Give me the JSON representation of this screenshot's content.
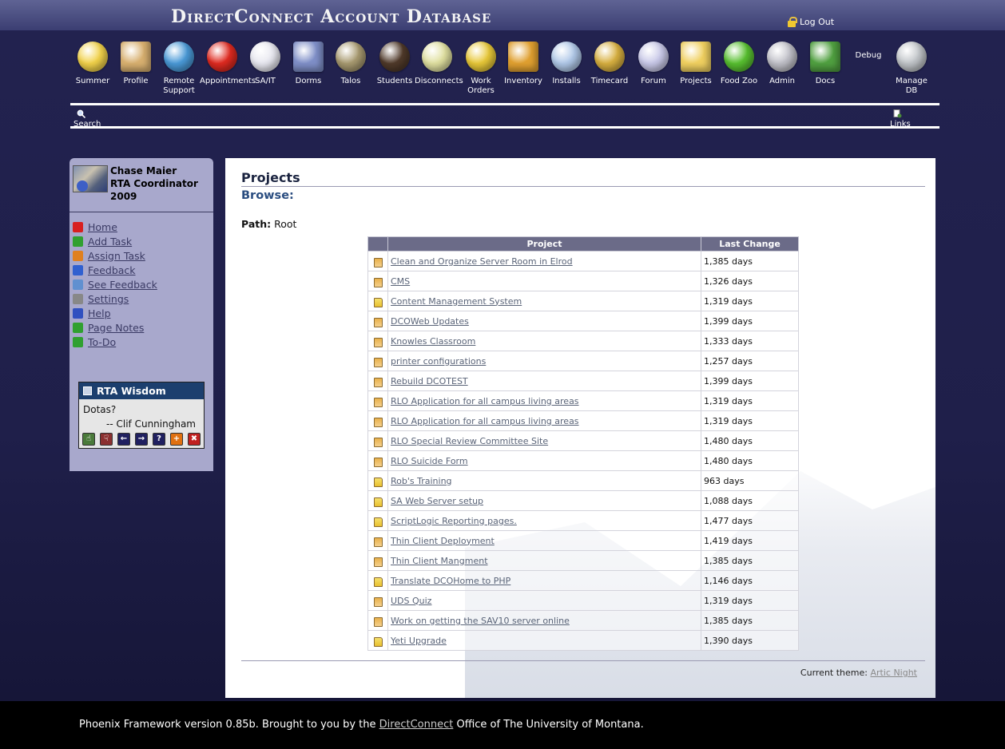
{
  "header": {
    "title": "DirectConnect Account Database",
    "logout_label": "Log Out"
  },
  "toolbar": [
    {
      "label": "Summer",
      "icon": "smiley-sunglasses-icon",
      "color": "#f2d24a"
    },
    {
      "label": "Profile",
      "icon": "profile-portrait-icon",
      "color": "#d8b070"
    },
    {
      "label": "Remote Support",
      "icon": "globe-help-icon",
      "color": "#4a9ad8"
    },
    {
      "label": "Appointments",
      "icon": "alarm-clock-icon",
      "color": "#e02a20"
    },
    {
      "label": "SA/IT",
      "icon": "medical-cross-icon",
      "color": "#e8e8f0"
    },
    {
      "label": "Dorms",
      "icon": "building-icon",
      "color": "#7f8fc8"
    },
    {
      "label": "Talos",
      "icon": "skull-helmet-icon",
      "color": "#a89a70"
    },
    {
      "label": "Students",
      "icon": "person-icon",
      "color": "#503a2a"
    },
    {
      "label": "Disconnects",
      "icon": "unplug-cable-icon",
      "color": "#e0e0a0"
    },
    {
      "label": "Work Orders",
      "icon": "note-pin-icon",
      "color": "#e8c838"
    },
    {
      "label": "Inventory",
      "icon": "box-icon",
      "color": "#e0a030"
    },
    {
      "label": "Installs",
      "icon": "install-disc-icon",
      "color": "#b0c8e8"
    },
    {
      "label": "Timecard",
      "icon": "money-bag-icon",
      "color": "#d8b040"
    },
    {
      "label": "Forum",
      "icon": "speech-bubbles-icon",
      "color": "#c8c8e8"
    },
    {
      "label": "Projects",
      "icon": "folder-icon",
      "color": "#f0d060"
    },
    {
      "label": "Food Zoo",
      "icon": "apple-icon",
      "color": "#58c030"
    },
    {
      "label": "Admin",
      "icon": "gears-icon",
      "color": "#c0c0c8"
    },
    {
      "label": "Docs",
      "icon": "books-icon",
      "color": "#50a040"
    },
    {
      "label": "Debug",
      "icon": "",
      "color": ""
    },
    {
      "label": "Manage DB",
      "icon": "database-check-icon",
      "color": "#c0c4c8"
    }
  ],
  "subnav": {
    "search_label": "Search",
    "links_label": "Links"
  },
  "user": {
    "name": "Chase Maier",
    "role": "RTA Coordinator",
    "year": "2009"
  },
  "side_menu": [
    {
      "label": "Home",
      "icon": "house-icon",
      "color": "#d82020"
    },
    {
      "label": "Add Task",
      "icon": "checkmark-icon",
      "color": "#30a030"
    },
    {
      "label": "Assign Task",
      "icon": "assign-icon",
      "color": "#e08020"
    },
    {
      "label": "Feedback",
      "icon": "info-icon",
      "color": "#3060d0"
    },
    {
      "label": "See Feedback",
      "icon": "magnifier-icon",
      "color": "#6090d0"
    },
    {
      "label": "Settings",
      "icon": "tools-icon",
      "color": "#888888"
    },
    {
      "label": "Help",
      "icon": "help-icon",
      "color": "#3050c0"
    },
    {
      "label": "Page Notes",
      "icon": "note-pencil-icon",
      "color": "#30a030"
    },
    {
      "label": "To-Do",
      "icon": "note-pencil-icon",
      "color": "#30a030"
    }
  ],
  "wisdom": {
    "title": "RTA Wisdom",
    "quote": "Dotas?",
    "author": "-- Clif Cunningham",
    "buttons": [
      {
        "icon": "thumbs-up-icon",
        "glyph": "☝",
        "color": "#4a7a3a"
      },
      {
        "icon": "thumbs-down-icon",
        "glyph": "☟",
        "color": "#8a3030"
      },
      {
        "icon": "arrow-left-icon",
        "glyph": "←",
        "color": "#202060"
      },
      {
        "icon": "arrow-right-icon",
        "glyph": "→",
        "color": "#202060"
      },
      {
        "icon": "question-icon",
        "glyph": "?",
        "color": "#202060"
      },
      {
        "icon": "add-icon",
        "glyph": "+",
        "color": "#e07010"
      },
      {
        "icon": "delete-icon",
        "glyph": "✖",
        "color": "#c02020"
      }
    ]
  },
  "main": {
    "title": "Projects",
    "subtitle": "Browse:",
    "path_label": "Path:",
    "path_value": "Root",
    "columns": [
      "Project",
      "Last Change"
    ],
    "rows": [
      {
        "icon": "clip",
        "name": "Clean and Organize Server Room in Elrod",
        "last": "1,385 days"
      },
      {
        "icon": "clip",
        "name": "CMS",
        "last": "1,326 days"
      },
      {
        "icon": "folder",
        "name": "Content Management System",
        "last": "1,319 days"
      },
      {
        "icon": "clip",
        "name": "DCOWeb Updates",
        "last": "1,399 days"
      },
      {
        "icon": "clip",
        "name": "Knowles Classroom",
        "last": "1,333 days"
      },
      {
        "icon": "clip",
        "name": "printer configurations",
        "last": "1,257 days"
      },
      {
        "icon": "clip",
        "name": "Rebuild DCOTEST",
        "last": "1,399 days"
      },
      {
        "icon": "clip",
        "name": "RLO Application for all campus living areas",
        "last": "1,319 days"
      },
      {
        "icon": "clip",
        "name": "RLO Application for all campus living areas",
        "last": "1,319 days"
      },
      {
        "icon": "clip",
        "name": "RLO Special Review Committee Site",
        "last": "1,480 days"
      },
      {
        "icon": "clip",
        "name": "RLO Suicide Form",
        "last": "1,480 days"
      },
      {
        "icon": "folder",
        "name": "Rob's Training",
        "last": "963 days"
      },
      {
        "icon": "folder",
        "name": "SA Web Server setup",
        "last": "1,088 days"
      },
      {
        "icon": "folder",
        "name": "ScriptLogic Reporting pages.",
        "last": "1,477 days"
      },
      {
        "icon": "clip",
        "name": "Thin Client Deployment",
        "last": "1,419 days"
      },
      {
        "icon": "clip",
        "name": "Thin Client Mangment",
        "last": "1,385 days"
      },
      {
        "icon": "folder",
        "name": "Translate DCOHome to PHP",
        "last": "1,146 days"
      },
      {
        "icon": "clip",
        "name": "UDS Quiz",
        "last": "1,319 days"
      },
      {
        "icon": "clip",
        "name": "Work on getting the SAV10 server online",
        "last": "1,385 days"
      },
      {
        "icon": "folder",
        "name": "Yeti Upgrade",
        "last": "1,390 days"
      }
    ],
    "theme_label": "Current theme:",
    "theme_value": "Artic Night"
  },
  "footer": {
    "before": "Phoenix Framework version 0.85b. Brought to you by the ",
    "link": "DirectConnect",
    "after": " Office of The University of Montana."
  }
}
